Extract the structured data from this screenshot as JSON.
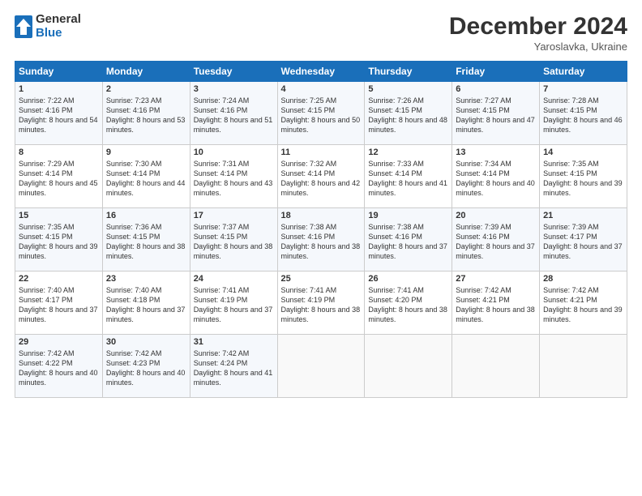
{
  "logo": {
    "general": "General",
    "blue": "Blue"
  },
  "header": {
    "title": "December 2024",
    "subtitle": "Yaroslavka, Ukraine"
  },
  "days_of_week": [
    "Sunday",
    "Monday",
    "Tuesday",
    "Wednesday",
    "Thursday",
    "Friday",
    "Saturday"
  ],
  "weeks": [
    [
      {
        "day": "1",
        "sunrise": "Sunrise: 7:22 AM",
        "sunset": "Sunset: 4:16 PM",
        "daylight": "Daylight: 8 hours and 54 minutes."
      },
      {
        "day": "2",
        "sunrise": "Sunrise: 7:23 AM",
        "sunset": "Sunset: 4:16 PM",
        "daylight": "Daylight: 8 hours and 53 minutes."
      },
      {
        "day": "3",
        "sunrise": "Sunrise: 7:24 AM",
        "sunset": "Sunset: 4:16 PM",
        "daylight": "Daylight: 8 hours and 51 minutes."
      },
      {
        "day": "4",
        "sunrise": "Sunrise: 7:25 AM",
        "sunset": "Sunset: 4:15 PM",
        "daylight": "Daylight: 8 hours and 50 minutes."
      },
      {
        "day": "5",
        "sunrise": "Sunrise: 7:26 AM",
        "sunset": "Sunset: 4:15 PM",
        "daylight": "Daylight: 8 hours and 48 minutes."
      },
      {
        "day": "6",
        "sunrise": "Sunrise: 7:27 AM",
        "sunset": "Sunset: 4:15 PM",
        "daylight": "Daylight: 8 hours and 47 minutes."
      },
      {
        "day": "7",
        "sunrise": "Sunrise: 7:28 AM",
        "sunset": "Sunset: 4:15 PM",
        "daylight": "Daylight: 8 hours and 46 minutes."
      }
    ],
    [
      {
        "day": "8",
        "sunrise": "Sunrise: 7:29 AM",
        "sunset": "Sunset: 4:14 PM",
        "daylight": "Daylight: 8 hours and 45 minutes."
      },
      {
        "day": "9",
        "sunrise": "Sunrise: 7:30 AM",
        "sunset": "Sunset: 4:14 PM",
        "daylight": "Daylight: 8 hours and 44 minutes."
      },
      {
        "day": "10",
        "sunrise": "Sunrise: 7:31 AM",
        "sunset": "Sunset: 4:14 PM",
        "daylight": "Daylight: 8 hours and 43 minutes."
      },
      {
        "day": "11",
        "sunrise": "Sunrise: 7:32 AM",
        "sunset": "Sunset: 4:14 PM",
        "daylight": "Daylight: 8 hours and 42 minutes."
      },
      {
        "day": "12",
        "sunrise": "Sunrise: 7:33 AM",
        "sunset": "Sunset: 4:14 PM",
        "daylight": "Daylight: 8 hours and 41 minutes."
      },
      {
        "day": "13",
        "sunrise": "Sunrise: 7:34 AM",
        "sunset": "Sunset: 4:14 PM",
        "daylight": "Daylight: 8 hours and 40 minutes."
      },
      {
        "day": "14",
        "sunrise": "Sunrise: 7:35 AM",
        "sunset": "Sunset: 4:15 PM",
        "daylight": "Daylight: 8 hours and 39 minutes."
      }
    ],
    [
      {
        "day": "15",
        "sunrise": "Sunrise: 7:35 AM",
        "sunset": "Sunset: 4:15 PM",
        "daylight": "Daylight: 8 hours and 39 minutes."
      },
      {
        "day": "16",
        "sunrise": "Sunrise: 7:36 AM",
        "sunset": "Sunset: 4:15 PM",
        "daylight": "Daylight: 8 hours and 38 minutes."
      },
      {
        "day": "17",
        "sunrise": "Sunrise: 7:37 AM",
        "sunset": "Sunset: 4:15 PM",
        "daylight": "Daylight: 8 hours and 38 minutes."
      },
      {
        "day": "18",
        "sunrise": "Sunrise: 7:38 AM",
        "sunset": "Sunset: 4:16 PM",
        "daylight": "Daylight: 8 hours and 38 minutes."
      },
      {
        "day": "19",
        "sunrise": "Sunrise: 7:38 AM",
        "sunset": "Sunset: 4:16 PM",
        "daylight": "Daylight: 8 hours and 37 minutes."
      },
      {
        "day": "20",
        "sunrise": "Sunrise: 7:39 AM",
        "sunset": "Sunset: 4:16 PM",
        "daylight": "Daylight: 8 hours and 37 minutes."
      },
      {
        "day": "21",
        "sunrise": "Sunrise: 7:39 AM",
        "sunset": "Sunset: 4:17 PM",
        "daylight": "Daylight: 8 hours and 37 minutes."
      }
    ],
    [
      {
        "day": "22",
        "sunrise": "Sunrise: 7:40 AM",
        "sunset": "Sunset: 4:17 PM",
        "daylight": "Daylight: 8 hours and 37 minutes."
      },
      {
        "day": "23",
        "sunrise": "Sunrise: 7:40 AM",
        "sunset": "Sunset: 4:18 PM",
        "daylight": "Daylight: 8 hours and 37 minutes."
      },
      {
        "day": "24",
        "sunrise": "Sunrise: 7:41 AM",
        "sunset": "Sunset: 4:19 PM",
        "daylight": "Daylight: 8 hours and 37 minutes."
      },
      {
        "day": "25",
        "sunrise": "Sunrise: 7:41 AM",
        "sunset": "Sunset: 4:19 PM",
        "daylight": "Daylight: 8 hours and 38 minutes."
      },
      {
        "day": "26",
        "sunrise": "Sunrise: 7:41 AM",
        "sunset": "Sunset: 4:20 PM",
        "daylight": "Daylight: 8 hours and 38 minutes."
      },
      {
        "day": "27",
        "sunrise": "Sunrise: 7:42 AM",
        "sunset": "Sunset: 4:21 PM",
        "daylight": "Daylight: 8 hours and 38 minutes."
      },
      {
        "day": "28",
        "sunrise": "Sunrise: 7:42 AM",
        "sunset": "Sunset: 4:21 PM",
        "daylight": "Daylight: 8 hours and 39 minutes."
      }
    ],
    [
      {
        "day": "29",
        "sunrise": "Sunrise: 7:42 AM",
        "sunset": "Sunset: 4:22 PM",
        "daylight": "Daylight: 8 hours and 40 minutes."
      },
      {
        "day": "30",
        "sunrise": "Sunrise: 7:42 AM",
        "sunset": "Sunset: 4:23 PM",
        "daylight": "Daylight: 8 hours and 40 minutes."
      },
      {
        "day": "31",
        "sunrise": "Sunrise: 7:42 AM",
        "sunset": "Sunset: 4:24 PM",
        "daylight": "Daylight: 8 hours and 41 minutes."
      },
      null,
      null,
      null,
      null
    ]
  ]
}
